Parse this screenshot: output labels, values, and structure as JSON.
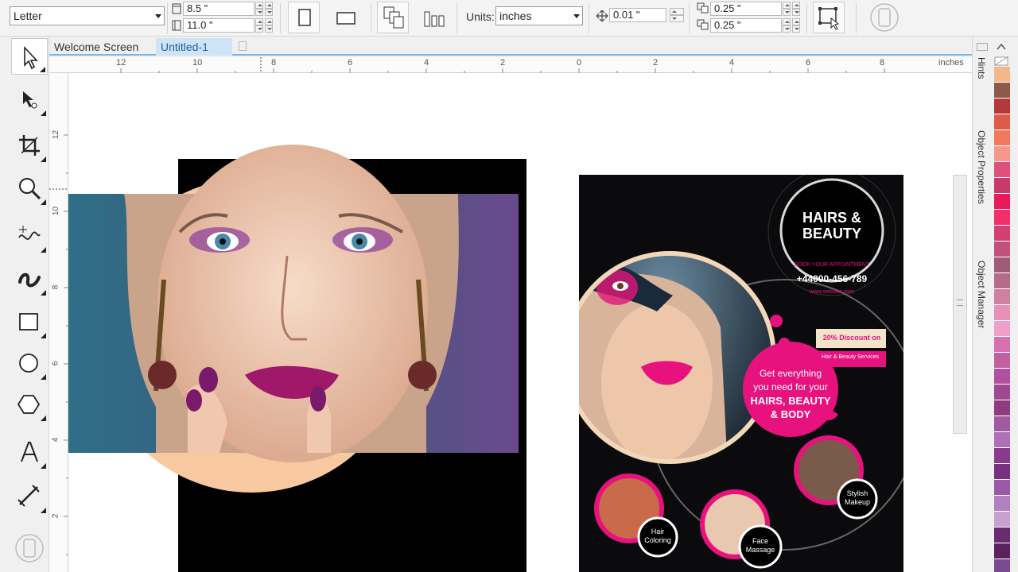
{
  "property_bar": {
    "page_size": "Letter",
    "width": "8.5 \"",
    "height": "11.0 \"",
    "units_label": "Units:",
    "units_value": "inches",
    "nudge": "0.01 \"",
    "dup_x": "0.25 \"",
    "dup_y": "0.25 \""
  },
  "tabs": [
    {
      "label": "Welcome Screen"
    },
    {
      "label": "Untitled-1"
    }
  ],
  "ruler": {
    "unit": "inches",
    "h_labels": [
      "12",
      "10",
      "8",
      "6",
      "4",
      "2",
      "0",
      "2",
      "4",
      "6",
      "8"
    ],
    "v_labels": [
      "12",
      "10",
      "8",
      "6",
      "4",
      "2"
    ]
  },
  "dockers": {
    "hints": "Hints",
    "object_properties": "Object Properties",
    "object_manager": "Object Manager"
  },
  "flyer": {
    "brand": "HAIRS & BEAUTY",
    "book": "BOOK YOUR APPOINTMENT",
    "phone": "+44000-456-789",
    "website": "www.website.com",
    "discount": "20% Discount on",
    "services": "Hair & Beauty Services",
    "cta_line1": "Get everything",
    "cta_line2": "you need for your",
    "cta_line3": "HAIRS, BEAUTY",
    "cta_line4": "& BODY",
    "service1": "Hair Coloring",
    "service2": "Face Massage",
    "service3": "Stylish Makeup"
  },
  "colors": {
    "accent": "#e8127e",
    "flyer_bg": "#0b0b0d",
    "ruler_accent": "#78b8e8"
  },
  "palette": [
    "#f5b78a",
    "#8c5a48",
    "#b33a3a",
    "#e05a4a",
    "#f07a5a",
    "#f59a8a",
    "#e0507a",
    "#c83a6a",
    "#e81a5a",
    "#f0306a",
    "#d04070",
    "#c05080",
    "#a05a7a",
    "#b86a8a",
    "#d080a0",
    "#e890b8",
    "#f0a0c8",
    "#d870b0",
    "#c060a0",
    "#b050a0",
    "#a04890",
    "#903a80",
    "#a05aa0",
    "#b070b8",
    "#8a3a8a",
    "#7a3080",
    "#9a5aa8",
    "#b080c0",
    "#c8a0d0",
    "#6a2a70",
    "#5a2060",
    "#7a4a90"
  ]
}
